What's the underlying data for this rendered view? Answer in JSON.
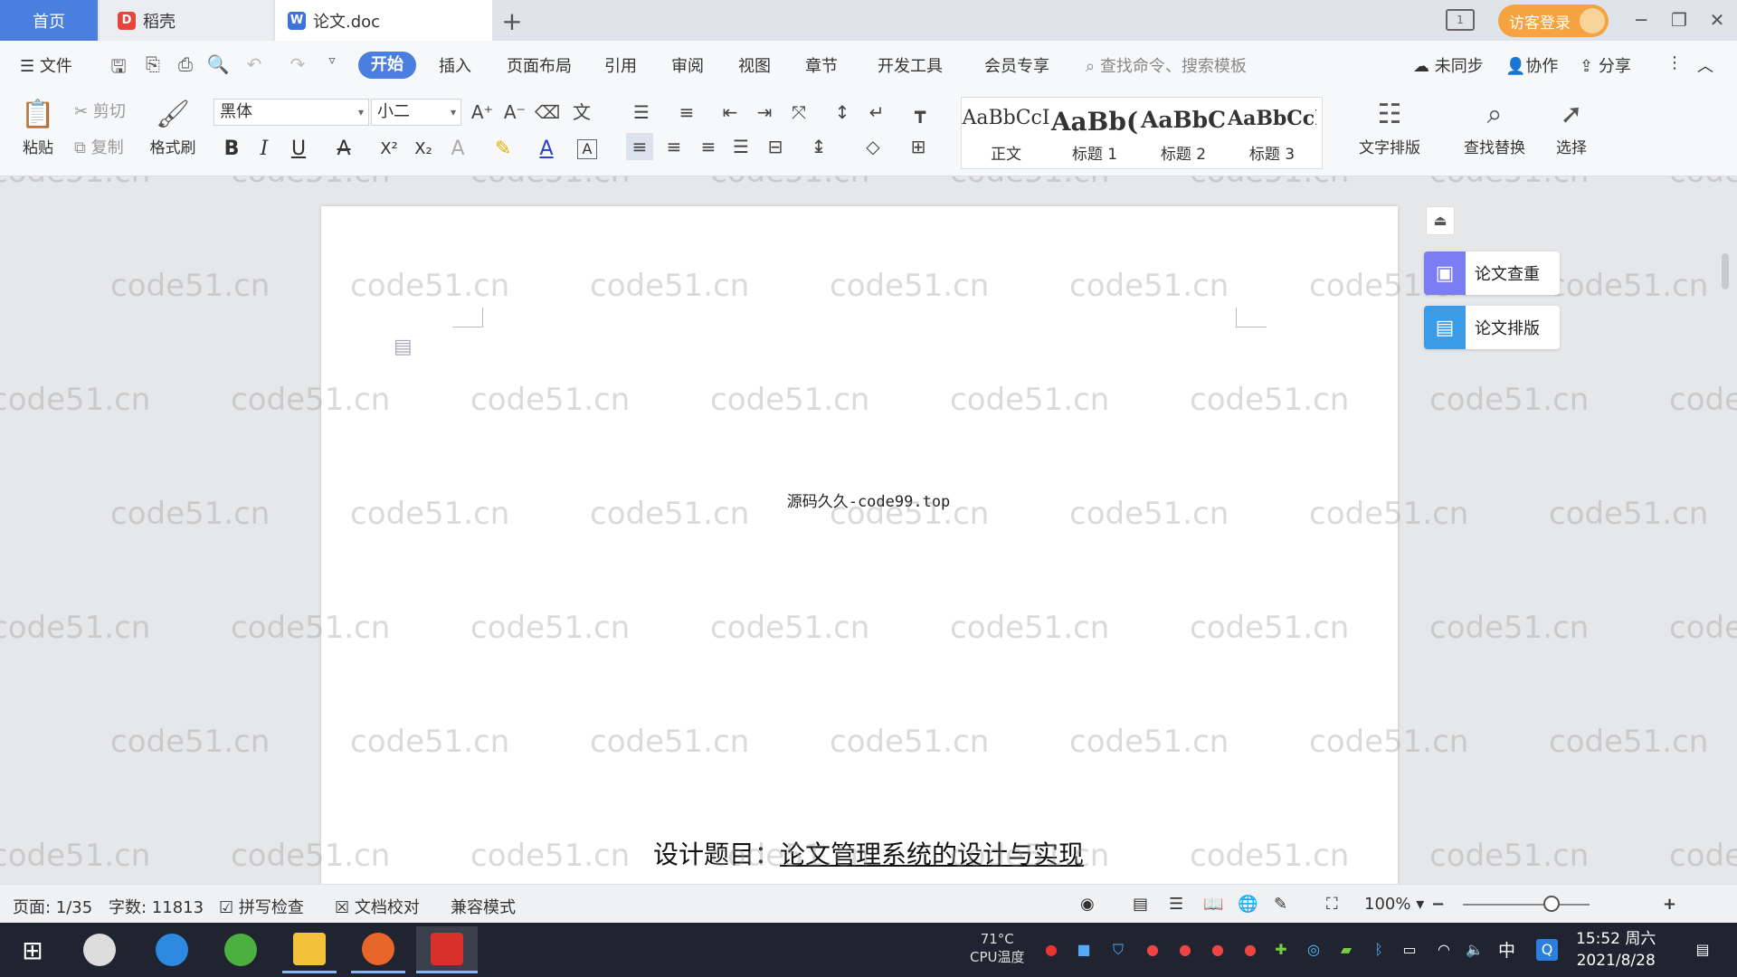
{
  "tabs": {
    "home": "首页",
    "daoke": "稻壳",
    "doc": "论文.doc",
    "new_tab": "+"
  },
  "titlebar": {
    "layout_btn": "1",
    "login": "访客登录",
    "minimize": "─",
    "restore": "❐",
    "close": "✕"
  },
  "menu": {
    "file": "文件",
    "start": "开始",
    "insert": "插入",
    "page_layout": "页面布局",
    "reference": "引用",
    "review": "审阅",
    "view": "视图",
    "chapter": "章节",
    "dev_tools": "开发工具",
    "member": "会员专享",
    "search_placeholder": "查找命令、搜索模板",
    "unsynced": "未同步",
    "collab": "协作",
    "share": "分享"
  },
  "ribbon": {
    "paste": "粘贴",
    "cut": "剪切",
    "copy": "复制",
    "format_painter": "格式刷",
    "font": "黑体",
    "size": "小二",
    "styles": [
      {
        "preview": "AaBbCcI",
        "name": "正文"
      },
      {
        "preview": "AaBb(",
        "name": "标题 1"
      },
      {
        "preview": "AaBbC",
        "name": "标题 2"
      },
      {
        "preview": "AaBbCcl",
        "name": "标题 3"
      }
    ],
    "text_layout": "文字排版",
    "find_replace": "查找替换",
    "select": "选择"
  },
  "document": {
    "source_line": "源码久久-code99.top",
    "heading_prefix": "设计题目：",
    "heading_title": "论文管理系统的设计与实现",
    "watermark": "code51.cn"
  },
  "side_panel": {
    "check": "论文查重",
    "format": "论文排版"
  },
  "status": {
    "page": "页面: 1/35",
    "words": "字数: 11813",
    "spell": "拼写检查",
    "proof": "文档校对",
    "compat": "兼容模式",
    "zoom": "100%"
  },
  "taskbar": {
    "cpu_temp": "71°C",
    "cpu_label": "CPU温度",
    "ime": "中",
    "time": "15:52 周六",
    "date": "2021/8/28"
  },
  "colors": {
    "accent": "#4a7fe0",
    "login": "#f4a340",
    "taskbar": "#1f2430"
  }
}
